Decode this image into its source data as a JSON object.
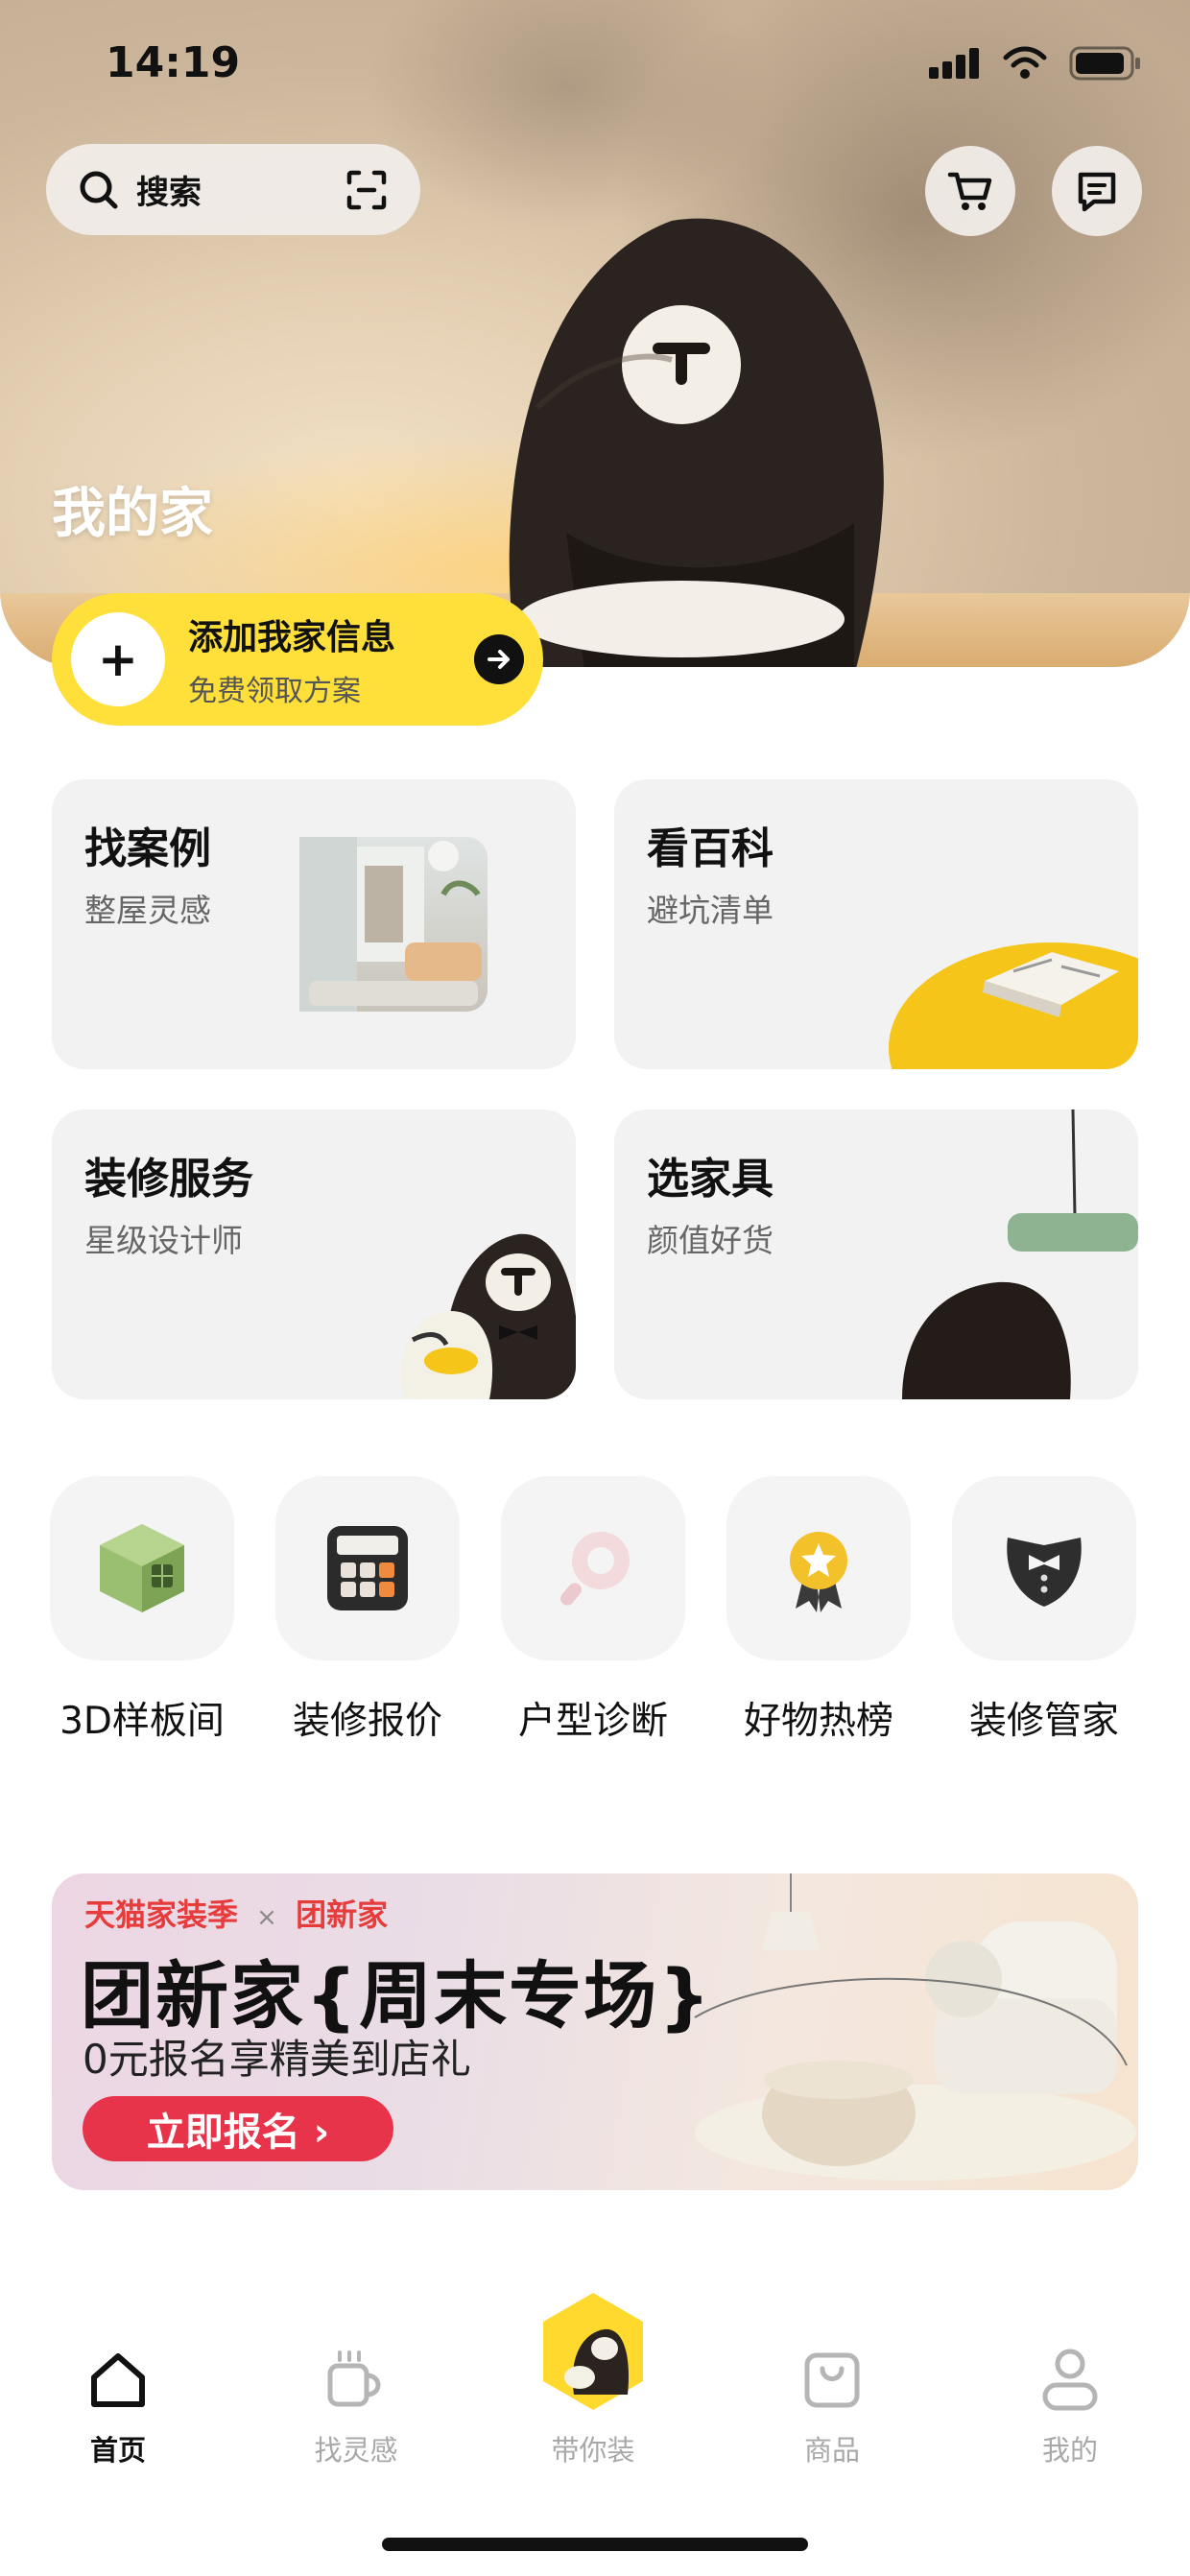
{
  "status_bar": {
    "time": "14:19"
  },
  "header": {
    "search_label": "搜索",
    "icons": [
      "search-icon",
      "scan-icon",
      "cart-icon",
      "message-icon"
    ]
  },
  "hero": {
    "title": "我的家",
    "add_info": {
      "title": "添加我家信息",
      "subtitle": "免费领取方案"
    }
  },
  "cards": [
    {
      "title": "找案例",
      "subtitle": "整屋灵感"
    },
    {
      "title": "看百科",
      "subtitle": "避坑清单"
    },
    {
      "title": "装修服务",
      "subtitle": "星级设计师"
    },
    {
      "title": "选家具",
      "subtitle": "颜值好货"
    }
  ],
  "shortcuts": [
    {
      "label": "3D样板间",
      "icon": "3d-cube-icon"
    },
    {
      "label": "装修报价",
      "icon": "calculator-icon"
    },
    {
      "label": "户型诊断",
      "icon": "magnifier-icon"
    },
    {
      "label": "好物热榜",
      "icon": "star-medal-icon"
    },
    {
      "label": "装修管家",
      "icon": "tuxedo-icon"
    }
  ],
  "banner": {
    "brand_left": "天猫家装季",
    "brand_sep": "×",
    "brand_right": "团新家",
    "headline": "团新家{周末专场}",
    "subline": "0元报名享精美到店礼",
    "cta": "立即报名 ›"
  },
  "tabbar": [
    {
      "label": "首页",
      "icon": "home-icon",
      "active": true
    },
    {
      "label": "找灵感",
      "icon": "cup-icon",
      "active": false
    },
    {
      "label": "带你装",
      "icon": "mascot-hexagon-icon",
      "active": false
    },
    {
      "label": "商品",
      "icon": "bag-icon",
      "active": false
    },
    {
      "label": "我的",
      "icon": "profile-icon",
      "active": false
    }
  ],
  "colors": {
    "accent_yellow": "#ffe03a",
    "cta_red": "#e8344a",
    "brand_red": "#e73c3c"
  }
}
